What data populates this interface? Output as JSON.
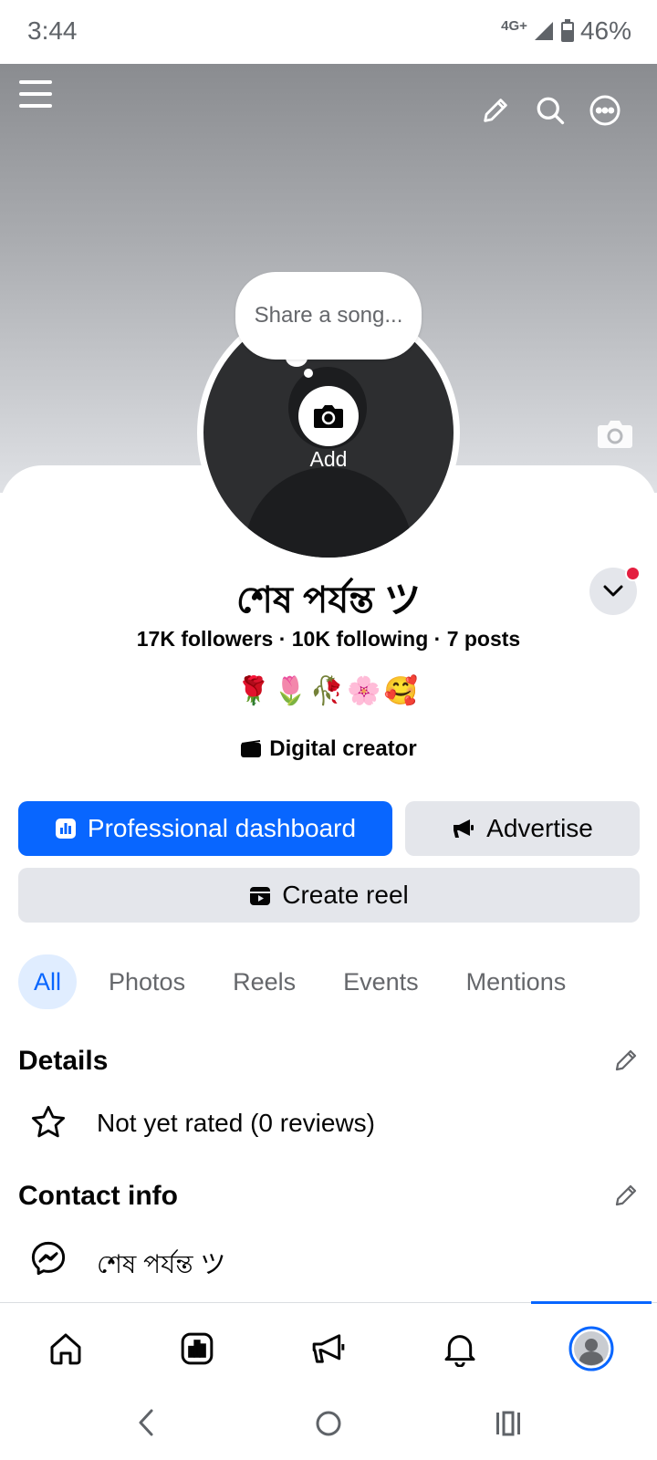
{
  "status": {
    "time": "3:44",
    "network": "4G+",
    "battery": "46%"
  },
  "cover": {
    "menu_icon": "hamburger-menu-icon",
    "edit_icon": "pencil-icon",
    "search_icon": "search-icon",
    "more_icon": "more-icon",
    "camera_icon": "camera-icon"
  },
  "avatar": {
    "bubble_text": "Share a song...",
    "add_label": "Add"
  },
  "profile": {
    "name": "শেষ পর্যন্ত ツ",
    "stats": "17K followers · 10K following · 7 posts",
    "bio": "🌹🌷🥀🌸🥰",
    "category": "Digital creator"
  },
  "actions": {
    "dashboard_label": "Professional dashboard",
    "advertise_label": "Advertise",
    "reel_label": "Create reel"
  },
  "tabs": [
    "All",
    "Photos",
    "Reels",
    "Events",
    "Mentions"
  ],
  "details": {
    "title": "Details",
    "rating_text": "Not yet rated (0 reviews)"
  },
  "contact": {
    "title": "Contact info",
    "messenger_text": "শেষ পর্যন্ত ツ"
  },
  "colors": {
    "accent": "#0866ff",
    "secondary_button": "#e4e6eb",
    "notification": "#e41e3f"
  },
  "bottom_nav": [
    "home-icon",
    "dashboard-icon",
    "megaphone-icon",
    "bell-icon",
    "profile-avatar-icon"
  ]
}
